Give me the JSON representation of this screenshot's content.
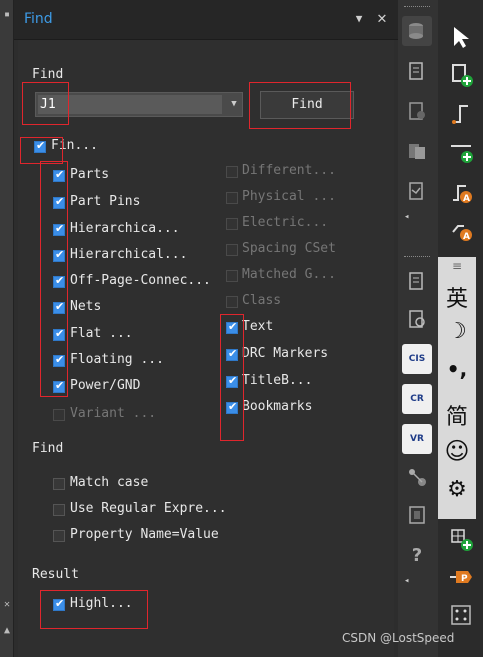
{
  "panel": {
    "title": "Find",
    "menu_glyph": "▼",
    "close_glyph": "✕"
  },
  "find_section": {
    "label": "Find",
    "combo_value": "J1",
    "combo_arrow": "▼",
    "find_button_label": "Find"
  },
  "master_checkbox": {
    "label": "Fin...",
    "checked": true
  },
  "left_options": [
    {
      "label": "Parts",
      "checked": true
    },
    {
      "label": "Part Pins",
      "checked": true
    },
    {
      "label": "Hierarchica...",
      "checked": true
    },
    {
      "label": "Hierarchical...",
      "checked": true
    },
    {
      "label": "Off-Page-Connec...",
      "checked": true
    },
    {
      "label": "Nets",
      "checked": true
    },
    {
      "label": "Flat ...",
      "checked": true
    },
    {
      "label": "Floating ...",
      "checked": true
    },
    {
      "label": "Power/GND",
      "checked": true
    },
    {
      "label": "Variant ...",
      "checked": false,
      "disabled": true
    }
  ],
  "right_options": [
    {
      "label": "Different...",
      "checked": false,
      "disabled": true
    },
    {
      "label": "Physical ...",
      "checked": false,
      "disabled": true
    },
    {
      "label": "Electric...",
      "checked": false,
      "disabled": true
    },
    {
      "label": "Spacing CSet",
      "checked": false,
      "disabled": true
    },
    {
      "label": "Matched G...",
      "checked": false,
      "disabled": true
    },
    {
      "label": "Class",
      "checked": false,
      "disabled": true
    },
    {
      "label": "Text",
      "checked": true
    },
    {
      "label": "DRC Markers",
      "checked": true
    },
    {
      "label": "TitleB...",
      "checked": true
    },
    {
      "label": "Bookmarks",
      "checked": true
    }
  ],
  "find_options": {
    "label": "Find",
    "items": [
      {
        "label": "Match case",
        "checked": false
      },
      {
        "label": "Use Regular Expre...",
        "checked": false
      },
      {
        "label": "Property Name=Value",
        "checked": false
      }
    ]
  },
  "result": {
    "label": "Result",
    "highlight": {
      "label": "Highl...",
      "checked": true
    }
  },
  "toolstrip": {
    "cis_label": "CIS",
    "cr_label": "CR",
    "vr_label": "VR"
  },
  "ime": {
    "lang": "英",
    "moon": "☽",
    "punct": "•,",
    "simplified": "简",
    "emoji": "☺",
    "settings": "⚙"
  },
  "watermark": "CSDN @LostSpeed",
  "colors": {
    "accent": "#3d9be6",
    "checkbox_on": "#3b8ee8",
    "annotation_red": "#e0262d"
  }
}
